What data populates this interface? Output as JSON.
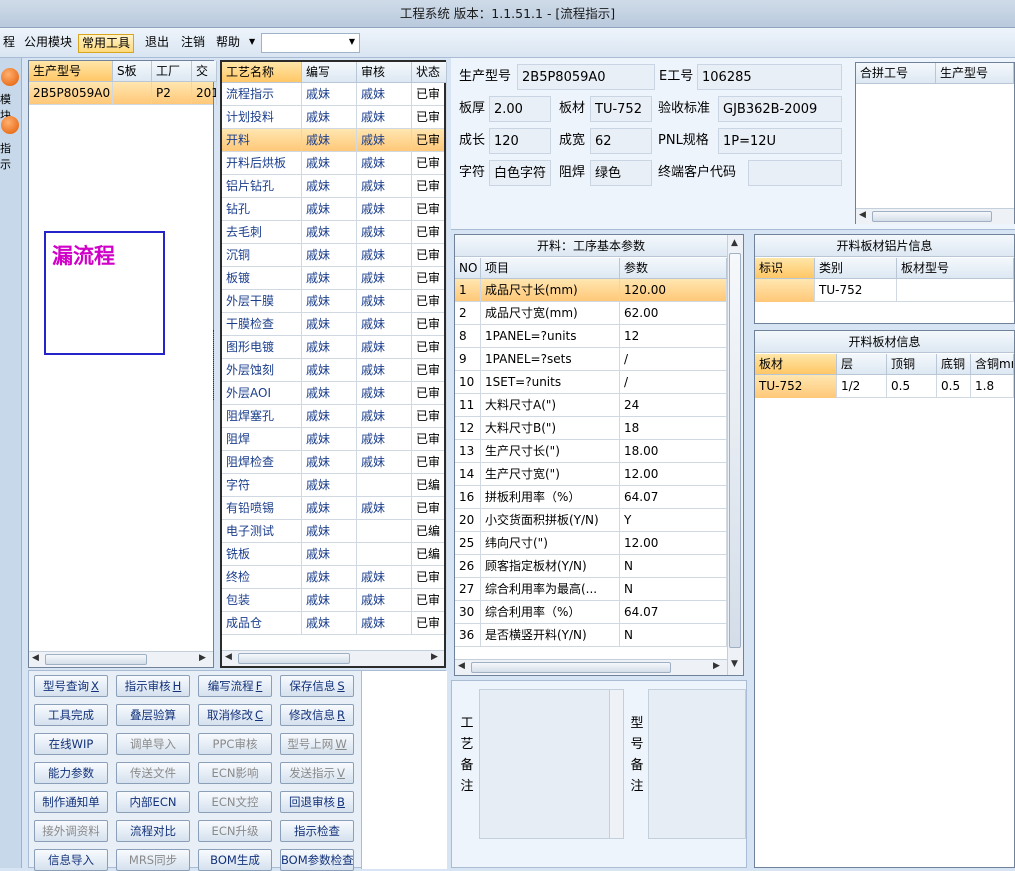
{
  "window": {
    "title": "工程系统   版本：1.1.51.1 - [流程指示]"
  },
  "menu": {
    "items": [
      "程",
      "公用模块",
      "常用工具",
      "退出",
      "注销",
      "帮助"
    ],
    "active_index": 2
  },
  "side": {
    "labels": [
      "模块",
      "指示"
    ]
  },
  "products": {
    "columns": [
      "生产型号",
      "S板",
      "工厂",
      "交"
    ],
    "rows": [
      [
        "2B5P8059A0",
        "",
        "P2",
        "201"
      ]
    ]
  },
  "leak_label": "漏流程",
  "process": {
    "columns": [
      "工艺名称",
      "编写",
      "审核",
      "状态"
    ],
    "selected": 2,
    "rows": [
      [
        "流程指示",
        "戚妹",
        "戚妹",
        "已审"
      ],
      [
        "计划投料",
        "戚妹",
        "戚妹",
        "已审"
      ],
      [
        "开料",
        "戚妹",
        "戚妹",
        "已审"
      ],
      [
        "开料后烘板",
        "戚妹",
        "戚妹",
        "已审"
      ],
      [
        "铝片钻孔",
        "戚妹",
        "戚妹",
        "已审"
      ],
      [
        "钻孔",
        "戚妹",
        "戚妹",
        "已审"
      ],
      [
        "去毛刺",
        "戚妹",
        "戚妹",
        "已审"
      ],
      [
        "沉铜",
        "戚妹",
        "戚妹",
        "已审"
      ],
      [
        "板镀",
        "戚妹",
        "戚妹",
        "已审"
      ],
      [
        "外层干膜",
        "戚妹",
        "戚妹",
        "已审"
      ],
      [
        "干膜检查",
        "戚妹",
        "戚妹",
        "已审"
      ],
      [
        "图形电镀",
        "戚妹",
        "戚妹",
        "已审"
      ],
      [
        "外层蚀刻",
        "戚妹",
        "戚妹",
        "已审"
      ],
      [
        "外层AOI",
        "戚妹",
        "戚妹",
        "已审"
      ],
      [
        "阻焊塞孔",
        "戚妹",
        "戚妹",
        "已审"
      ],
      [
        "阻焊",
        "戚妹",
        "戚妹",
        "已审"
      ],
      [
        "阻焊检查",
        "戚妹",
        "戚妹",
        "已审"
      ],
      [
        "字符",
        "戚妹",
        "",
        "已编"
      ],
      [
        "有铅喷锡",
        "戚妹",
        "戚妹",
        "已审"
      ],
      [
        "电子测试",
        "戚妹",
        "",
        "已编"
      ],
      [
        "铣板",
        "戚妹",
        "",
        "已编"
      ],
      [
        "终检",
        "戚妹",
        "戚妹",
        "已审"
      ],
      [
        "包装",
        "戚妹",
        "戚妹",
        "已审"
      ],
      [
        "成品仓",
        "戚妹",
        "戚妹",
        "已审"
      ]
    ]
  },
  "buttons": [
    [
      "型号查询",
      "X",
      false
    ],
    [
      "指示审核",
      "H",
      false
    ],
    [
      "编写流程",
      "F",
      false
    ],
    [
      "保存信息",
      "S",
      false
    ],
    [
      "工具完成",
      "",
      false
    ],
    [
      "叠层验算",
      "",
      false
    ],
    [
      "取消修改",
      "C",
      false
    ],
    [
      "修改信息",
      "R",
      false
    ],
    [
      "在线WIP",
      "",
      false
    ],
    [
      "调单导入",
      "",
      true
    ],
    [
      "PPC审核",
      "",
      true
    ],
    [
      "型号上网",
      "W",
      true
    ],
    [
      "能力参数",
      "",
      false
    ],
    [
      "传送文件",
      "",
      true
    ],
    [
      "ECN影响",
      "",
      true
    ],
    [
      "发送指示",
      "V",
      true
    ],
    [
      "制作通知单",
      "",
      false
    ],
    [
      "内部ECN",
      "",
      false
    ],
    [
      "ECN文控",
      "",
      true
    ],
    [
      "回退审核",
      "B",
      false
    ],
    [
      "接外调资料",
      "",
      true
    ],
    [
      "流程对比",
      "",
      false
    ],
    [
      "ECN升级",
      "",
      true
    ],
    [
      "指示检查",
      "",
      false
    ],
    [
      "信息导入",
      "",
      false
    ],
    [
      "MRS同步",
      "",
      true
    ],
    [
      "BOM生成",
      "",
      false
    ],
    [
      "BOM参数检查",
      "",
      false
    ]
  ],
  "info": {
    "product_label": "生产型号",
    "product": "2B5P8059A0",
    "e_label": "E工号",
    "e_no": "106285",
    "thick_label": "板厚",
    "thick": "2.00",
    "mat_label": "板材",
    "mat": "TU-752",
    "std_label": "验收标准",
    "std": "GJB362B-2009",
    "len_label": "成长",
    "len": "120",
    "wid_label": "成宽",
    "wid": "62",
    "pnl_label": "PNL规格",
    "pnl": "1P=12U",
    "char_label": "字符",
    "char": "白色字符",
    "mask_label": "阻焊",
    "mask": "绿色",
    "cust_label": "终端客户代码",
    "cust": ""
  },
  "merge": {
    "columns": [
      "合拼工号",
      "生产型号"
    ]
  },
  "params": {
    "title": "开料：工序基本参数",
    "columns": [
      "NO",
      "项目",
      "参数"
    ],
    "selected": 0,
    "rows": [
      [
        "1",
        "成品尺寸长(mm)",
        "120.00"
      ],
      [
        "2",
        "成品尺寸宽(mm)",
        "62.00"
      ],
      [
        "8",
        "1PANEL=?units",
        "12"
      ],
      [
        "9",
        "1PANEL=?sets",
        "/"
      ],
      [
        "10",
        "1SET=?units",
        "/"
      ],
      [
        "11",
        "大料尺寸A(\")",
        "24"
      ],
      [
        "12",
        "大料尺寸B(\")",
        "18"
      ],
      [
        "13",
        "生产尺寸长(\")",
        "18.00"
      ],
      [
        "14",
        "生产尺寸宽(\")",
        "12.00"
      ],
      [
        "16",
        "拼板利用率（%）",
        "64.07"
      ],
      [
        "20",
        "小交货面积拼板(Y/N)",
        "Y"
      ],
      [
        "25",
        "纬向尺寸(\")",
        "12.00"
      ],
      [
        "26",
        "顾客指定板材(Y/N)",
        "N"
      ],
      [
        "27",
        "综合利用率为最高(...",
        "N"
      ],
      [
        "30",
        "综合利用率（%）",
        "64.07"
      ],
      [
        "36",
        "是否横竖开料(Y/N)",
        "N"
      ]
    ]
  },
  "alum": {
    "title": "开料板材铝片信息",
    "columns": [
      "标识",
      "类别",
      "板材型号"
    ],
    "rows": [
      [
        "",
        "TU-752",
        ""
      ]
    ]
  },
  "mats": {
    "title": "开料板材信息",
    "columns": [
      "板材",
      "层",
      "顶铜",
      "底铜",
      "含铜mm"
    ],
    "rows": [
      [
        "TU-752",
        "1/2",
        "0.5",
        "0.5",
        "1.8"
      ]
    ]
  },
  "notes": {
    "process_label": "工艺备注",
    "model_label": "型号备注"
  }
}
